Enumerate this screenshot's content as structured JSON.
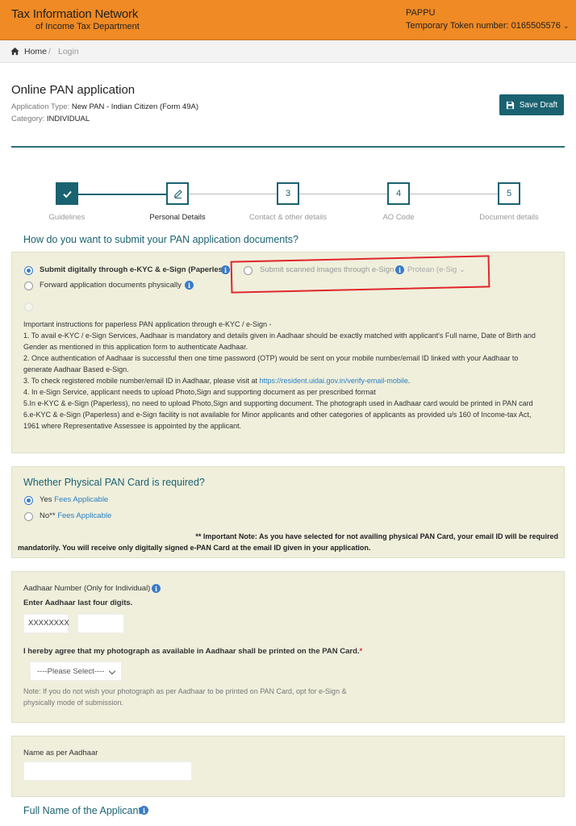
{
  "header": {
    "brand_line1": "Tax Information Network",
    "brand_line2": "of Income Tax Department",
    "user": "PAPPU",
    "token": "Temporary Token number: 0165505576"
  },
  "breadcrumb": {
    "home": "Home",
    "separator": "/",
    "current": "Login"
  },
  "page": {
    "title": "Online PAN application",
    "app_type_label": "Application Type:",
    "app_type_value": "New PAN - Indian Citizen (Form 49A)",
    "category_label": "Category:",
    "category_value": "INDIVIDUAL",
    "save_draft": "Save Draft"
  },
  "steps": [
    {
      "num": "",
      "label": "Guidelines",
      "state": "done"
    },
    {
      "num": "",
      "label": "Personal Details",
      "state": "active"
    },
    {
      "num": "3",
      "label": "Contact & other details",
      "state": "pending"
    },
    {
      "num": "4",
      "label": "AO Code",
      "state": "pending"
    },
    {
      "num": "5",
      "label": "Document details",
      "state": "pending"
    }
  ],
  "submit_section": {
    "question": "How do you want to submit your PAN application documents?",
    "opt_ekyc": "Submit digitally through e-KYC & e-Sign (Paperless)",
    "opt_scanned": "Submit scanned images through e-Sign",
    "opt_scanned_select": "Protean (e-Sig",
    "opt_physical": "Forward application documents physically",
    "instructions": [
      "Important instructions for paperless PAN application through e-KYC / e-Sign -",
      "1. To avail e-KYC / e-Sign Services, Aadhaar is mandatory and details given in Aadhaar should be exactly matched with applicant's Full name, Date of Birth and Gender as mentioned in this application form to authenticate Aadhaar.",
      "2. Once authentication of Aadhaar is successful then one time password (OTP) would be sent on your mobile number/email ID linked with your Aadhaar to generate Aadhaar Based e-Sign."
    ],
    "instr3_prefix": "3. To check registered mobile number/email ID in Aadhaar, please visit at ",
    "instr3_link": "https://resident.uidai.gov.in/verify-email-mobile",
    "instr3_suffix": ".",
    "instructions_rest": [
      "4. In e-Sign Service, applicant needs to upload Photo,Sign and supporting document as per prescribed format",
      "5.In e-KYC & e-Sign (Paperless), no need to upload Photo,Sign and supporting document. The photograph used in Aadhaar card would be printed in PAN card",
      "6.e-KYC & e-Sign (Paperless) and e-Sign facility is not available for Minor applicants and other categories of applicants as provided u/s 160 of Income-tax Act, 1961 where Representative Assessee is appointed by the applicant."
    ]
  },
  "physical_section": {
    "question": "Whether Physical PAN Card is required?",
    "yes": "Yes",
    "yes_fee": "Fees Applicable",
    "no": "No**",
    "no_fee": "Fees Applicable",
    "note_line1": "** Important Note: As you have selected for not availing physical PAN Card, your email ID will be required",
    "note_line2": "mandatorily. You will receive only digitally signed e-PAN Card at the email ID given in your application."
  },
  "aadhaar_section": {
    "label": "Aadhaar Number (Only for Individual)",
    "last4_label": "Enter Aadhaar last four digits.",
    "masked": "XXXXXXXX",
    "last4_value": "",
    "agree_label": "I hereby agree that my photograph as available in Aadhaar shall be printed on the PAN Card.",
    "required_mark": "*",
    "select_value": "----Please Select----",
    "note": "Note: If you do not wish your photograph as per Aadhaar to be printed on PAN Card, opt for e-Sign & physically mode of submission."
  },
  "name_section": {
    "label": "Name as per Aadhaar",
    "value": "",
    "full_name_title": "Full Name of the Applicant"
  },
  "colors": {
    "header": "#f08a24",
    "accent": "#1a6270",
    "panel": "#efefdc",
    "link": "#2a7fc0",
    "highlight": "#e0262b"
  }
}
